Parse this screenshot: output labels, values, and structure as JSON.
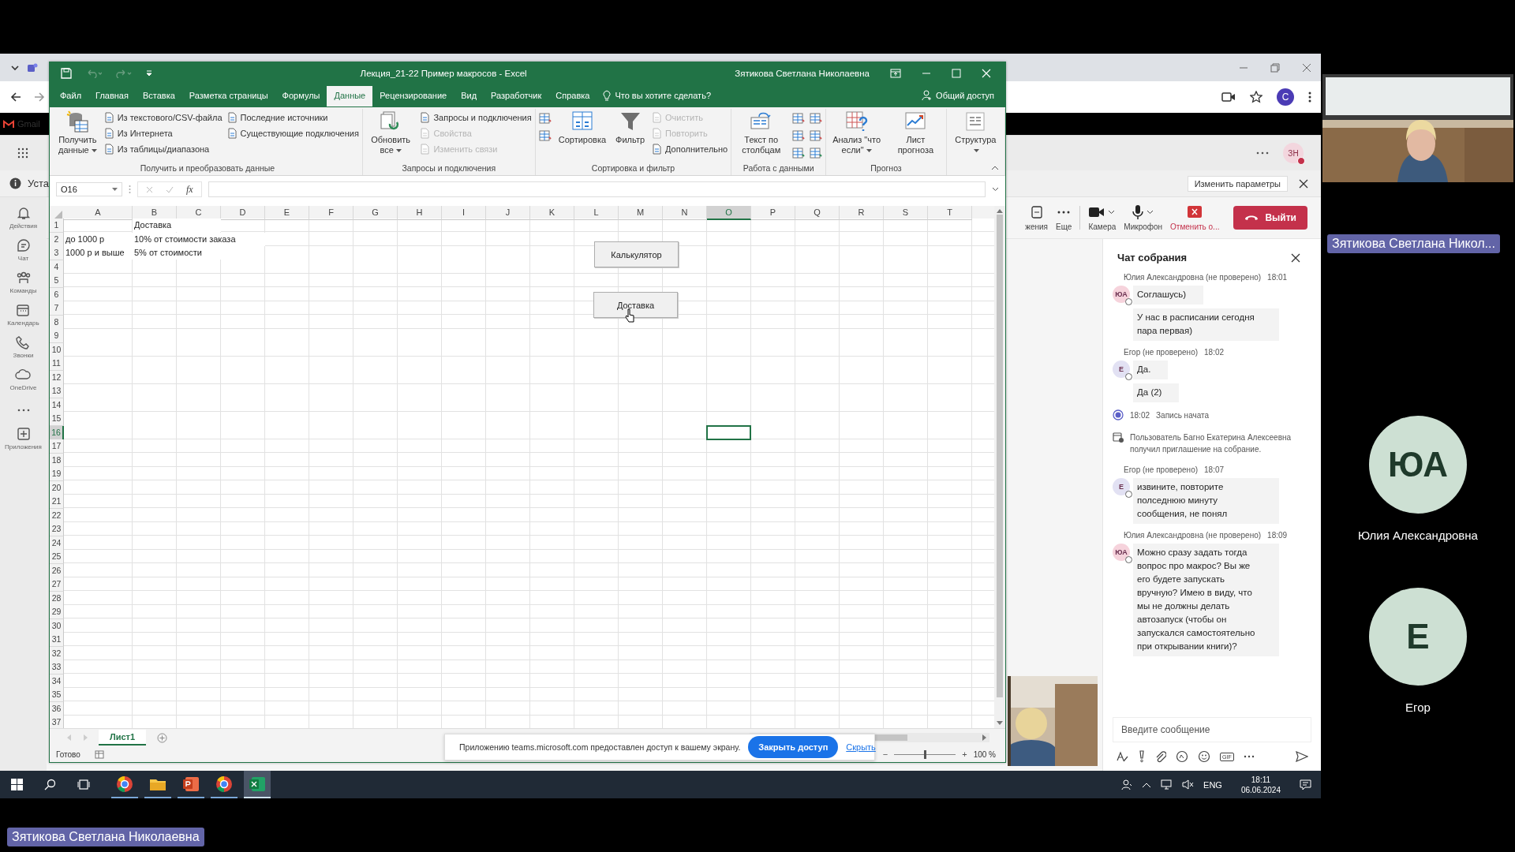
{
  "browser": {
    "bookmark": "Gmail",
    "profile": "C"
  },
  "teams": {
    "user_initials": "ЗН",
    "notice": "Уста",
    "notice_button": "Изменить параметры",
    "rail": [
      {
        "label": "Действия"
      },
      {
        "label": "Чат"
      },
      {
        "label": "Команды"
      },
      {
        "label": "Календарь"
      },
      {
        "label": "Звонки"
      },
      {
        "label": "OneDrive"
      }
    ],
    "rail_apps": "Приложения",
    "controls": [
      {
        "label": "жения"
      },
      {
        "label": "Еще"
      },
      {
        "label": "Камера"
      },
      {
        "label": "Микрофон"
      },
      {
        "label": "Отменить о..."
      }
    ],
    "leave": "Выйти",
    "chat": {
      "title": "Чат собрания",
      "placeholder": "Введите сообщение",
      "gif": "GIF",
      "items": [
        {
          "kind": "meta",
          "author": "Юлия Александровна (не проверено)",
          "time": "18:01"
        },
        {
          "kind": "bubble",
          "initials": "ЮА",
          "color": "#f6d3dc",
          "text": "Соглашусь)"
        },
        {
          "kind": "bubble",
          "text": "У нас в расписании сегодня пара первая)"
        },
        {
          "kind": "meta",
          "author": "Егор (не проверено)",
          "time": "18:02"
        },
        {
          "kind": "bubble",
          "initials": "Е",
          "color": "#e2e1f3",
          "text": "Да."
        },
        {
          "kind": "bubble",
          "text": "Да (2)"
        },
        {
          "kind": "record",
          "time": "18:02",
          "text": "Запись начата"
        },
        {
          "kind": "invite",
          "text": "Пользователь Багно Екатерина Алексеевна получил приглашение на собрание."
        },
        {
          "kind": "meta",
          "author": "Егор (не проверено)",
          "time": "18:07"
        },
        {
          "kind": "bubble",
          "initials": "Е",
          "color": "#e2e1f3",
          "text": "извините, повторите полседнюю минуту сообщения, не понял"
        },
        {
          "kind": "meta",
          "author": "Юлия Александровна (не проверено)",
          "time": "18:09"
        },
        {
          "kind": "bubble",
          "initials": "ЮА",
          "color": "#f6d3dc",
          "text": "Можно сразу задать тогда вопрос про макрос? Вы же его будете запускать вручную? Имею в виду, что мы не должны делать автозапуск (чтобы он запускался самостоятельно при открывании книги)?"
        }
      ]
    }
  },
  "excel": {
    "title": "Лекция_21-22 Пример макросов  -  Excel",
    "user": "Зятикова Светлана Николаевна",
    "tabs": [
      {
        "label": "Файл",
        "selected": false
      },
      {
        "label": "Главная",
        "selected": false
      },
      {
        "label": "Вставка",
        "selected": false
      },
      {
        "label": "Разметка страницы",
        "selected": false
      },
      {
        "label": "Формулы",
        "selected": false
      },
      {
        "label": "Данные",
        "selected": true
      },
      {
        "label": "Рецензирование",
        "selected": false
      },
      {
        "label": "Вид",
        "selected": false
      },
      {
        "label": "Разработчик",
        "selected": false
      },
      {
        "label": "Справка",
        "selected": false
      }
    ],
    "tell_me": "Что вы хотите сделать?",
    "share": "Общий доступ",
    "ribbon": [
      {
        "label": "Получить и преобразовать данные",
        "columns": [
          [
            {
              "kind": "large",
              "label": "Получить данные",
              "dropdown": true,
              "disabled": false
            }
          ],
          [
            {
              "kind": "small",
              "label": "Из текстового/CSV-файла",
              "disabled": false
            },
            {
              "kind": "small",
              "label": "Из Интернета",
              "disabled": false
            },
            {
              "kind": "small",
              "label": "Из таблицы/диапазона",
              "disabled": false
            }
          ],
          [
            {
              "kind": "small",
              "label": "Последние источники",
              "disabled": false
            },
            {
              "kind": "small",
              "label": "Существующие подключения",
              "disabled": false
            }
          ]
        ]
      },
      {
        "label": "Запросы и подключения",
        "columns": [
          [
            {
              "kind": "large",
              "label": "Обновить все",
              "dropdown": true,
              "disabled": false
            }
          ],
          [
            {
              "kind": "small",
              "label": "Запросы и подключения",
              "disabled": false
            },
            {
              "kind": "small",
              "label": "Свойства",
              "disabled": true
            },
            {
              "kind": "small",
              "label": "Изменить связи",
              "disabled": true
            }
          ]
        ]
      },
      {
        "label": "Сортировка и фильтр",
        "columns": [
          [
            {
              "kind": "icon",
              "disabled": false
            },
            {
              "kind": "icon",
              "disabled": false
            }
          ],
          [
            {
              "kind": "large",
              "label": "Сортировка",
              "dropdown": false,
              "disabled": false
            }
          ],
          [
            {
              "kind": "large",
              "label": "Фильтр",
              "dropdown": false,
              "disabled": false
            }
          ],
          [
            {
              "kind": "small",
              "label": "Очистить",
              "disabled": true
            },
            {
              "kind": "small",
              "label": "Повторить",
              "disabled": true
            },
            {
              "kind": "small",
              "label": "Дополнительно",
              "disabled": false
            }
          ]
        ]
      },
      {
        "label": "Работа с данными",
        "columns": [
          [
            {
              "kind": "large",
              "label": "Текст по столбцам",
              "dropdown": false,
              "disabled": false
            }
          ],
          [
            {
              "kind": "icon",
              "disabled": false
            },
            {
              "kind": "icon",
              "disabled": false
            },
            {
              "kind": "icon",
              "disabled": false
            }
          ],
          [
            {
              "kind": "icon",
              "disabled": false
            },
            {
              "kind": "icon",
              "disabled": false
            },
            {
              "kind": "icon",
              "disabled": false
            }
          ]
        ]
      },
      {
        "label": "Прогноз",
        "columns": [
          [
            {
              "kind": "large",
              "label": "Анализ \"что если\"",
              "dropdown": true,
              "disabled": false
            }
          ],
          [
            {
              "kind": "large",
              "label": "Лист прогноза",
              "dropdown": false,
              "disabled": false
            }
          ]
        ]
      },
      {
        "columns": [
          [
            {
              "kind": "large",
              "label": "Структура",
              "dropdown": true,
              "disabled": false
            }
          ]
        ]
      }
    ],
    "name_box": "O16",
    "fx": "fx",
    "columns": [
      {
        "letter": "A",
        "selected": false
      },
      {
        "letter": "B",
        "selected": false
      },
      {
        "letter": "C",
        "selected": false
      },
      {
        "letter": "D",
        "selected": false
      },
      {
        "letter": "E",
        "selected": false
      },
      {
        "letter": "F",
        "selected": false
      },
      {
        "letter": "G",
        "selected": false
      },
      {
        "letter": "H",
        "selected": false
      },
      {
        "letter": "I",
        "selected": false
      },
      {
        "letter": "J",
        "selected": false
      },
      {
        "letter": "K",
        "selected": false
      },
      {
        "letter": "L",
        "selected": false
      },
      {
        "letter": "M",
        "selected": false
      },
      {
        "letter": "N",
        "selected": false
      },
      {
        "letter": "O",
        "selected": true
      },
      {
        "letter": "P",
        "selected": false
      },
      {
        "letter": "Q",
        "selected": false
      },
      {
        "letter": "R",
        "selected": false
      },
      {
        "letter": "S",
        "selected": false
      },
      {
        "letter": "T",
        "selected": false
      }
    ],
    "rows": [
      {
        "number": "1",
        "selected": false,
        "cells": [
          null,
          "Доставка"
        ]
      },
      {
        "number": "2",
        "selected": false,
        "cells": [
          "до 1000 р",
          "10% от стоимости заказа"
        ]
      },
      {
        "number": "3",
        "selected": false,
        "cells": [
          "1000 р и выше",
          "5% от стоимости"
        ]
      },
      {
        "number": "4",
        "selected": false
      },
      {
        "number": "5",
        "selected": false
      },
      {
        "number": "6",
        "selected": false
      },
      {
        "number": "7",
        "selected": false
      },
      {
        "number": "8",
        "selected": false
      },
      {
        "number": "9",
        "selected": false
      },
      {
        "number": "10",
        "selected": false
      },
      {
        "number": "11",
        "selected": false
      },
      {
        "number": "12",
        "selected": false
      },
      {
        "number": "13",
        "selected": false
      },
      {
        "number": "14",
        "selected": false
      },
      {
        "number": "15",
        "selected": false
      },
      {
        "number": "16",
        "selected": true
      },
      {
        "number": "17",
        "selected": false
      },
      {
        "number": "18",
        "selected": false
      },
      {
        "number": "19",
        "selected": false
      },
      {
        "number": "20",
        "selected": false
      },
      {
        "number": "21",
        "selected": false
      },
      {
        "number": "22",
        "selected": false
      },
      {
        "number": "23",
        "selected": false
      },
      {
        "number": "24",
        "selected": false
      },
      {
        "number": "25",
        "selected": false
      },
      {
        "number": "26",
        "selected": false
      },
      {
        "number": "27",
        "selected": false
      },
      {
        "number": "28",
        "selected": false
      },
      {
        "number": "29",
        "selected": false
      },
      {
        "number": "30",
        "selected": false
      },
      {
        "number": "31",
        "selected": false
      },
      {
        "number": "32",
        "selected": false
      },
      {
        "number": "33",
        "selected": false
      },
      {
        "number": "34",
        "selected": false
      },
      {
        "number": "35",
        "selected": false
      },
      {
        "number": "36",
        "selected": false
      },
      {
        "number": "37",
        "selected": false
      }
    ],
    "macro_buttons": [
      "Калькулятор",
      "Доставка"
    ],
    "sheets": [
      {
        "label": "Лист1",
        "selected": true
      }
    ],
    "status": "Готово",
    "zoom": {
      "out": "−",
      "in": "+",
      "level": 0.5,
      "reading": "100 %"
    }
  },
  "share_bar": {
    "text": "Приложению teams.microsoft.com предоставлен доступ к вашему экрану.",
    "button": "Закрыть доступ",
    "link": "Скрыть"
  },
  "taskbar": {
    "apps": [
      {
        "selected": false
      },
      {
        "selected": false
      },
      {
        "selected": false
      },
      {
        "selected": false
      },
      {
        "selected": true
      }
    ],
    "lang": "ENG",
    "time": "18:11",
    "date": "06.06.2024"
  },
  "video": {
    "presenter": "Зятикова Светлана Никол...",
    "participants": [
      {
        "initials": "ЮА",
        "name": "Юлия Александровна"
      },
      {
        "initials": "Е",
        "name": "Егор"
      }
    ],
    "bottom_label": "Зятикова Светлана Николаевна"
  }
}
